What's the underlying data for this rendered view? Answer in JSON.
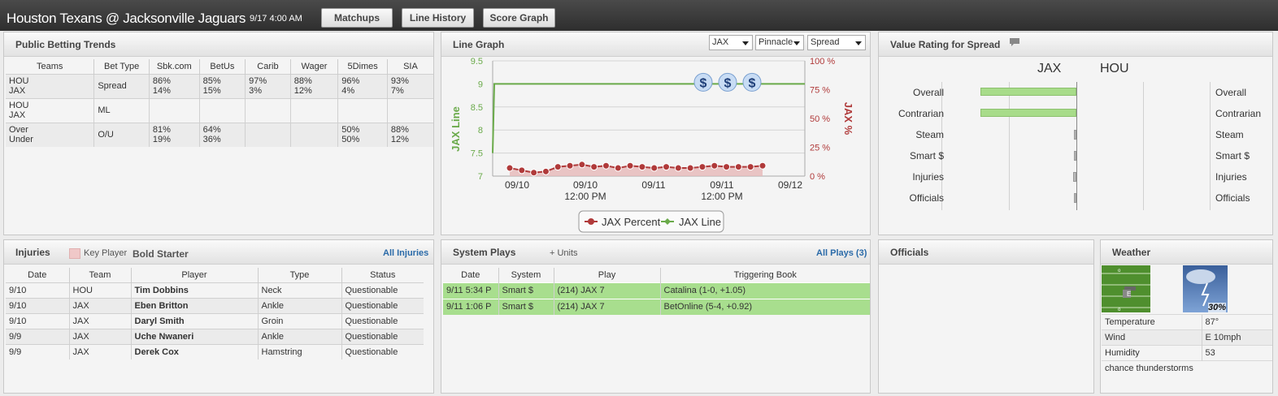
{
  "header": {
    "title": "Houston Texans @ Jacksonville Jaguars",
    "time": "9/17 4:00 AM",
    "buttons": [
      "Matchups",
      "Line History",
      "Score Graph"
    ]
  },
  "betting": {
    "title": "Public Betting Trends",
    "columns": [
      "Teams",
      "Bet Type",
      "Sbk.com",
      "BetUs",
      "Carib",
      "Wager",
      "5Dimes",
      "SIA"
    ],
    "rows": [
      {
        "teams": [
          "HOU",
          "JAX"
        ],
        "type": "Spread",
        "vals": [
          [
            "86%",
            "14%"
          ],
          [
            "85%",
            "15%"
          ],
          [
            "97%",
            "3%"
          ],
          [
            "88%",
            "12%"
          ],
          [
            "96%",
            "4%"
          ],
          [
            "93%",
            "7%"
          ]
        ]
      },
      {
        "teams": [
          "HOU",
          "JAX"
        ],
        "type": "ML",
        "vals": [
          [
            "",
            ""
          ],
          [
            "",
            ""
          ],
          [
            "",
            ""
          ],
          [
            "",
            ""
          ],
          [
            "",
            ""
          ],
          [
            "",
            ""
          ]
        ]
      },
      {
        "teams": [
          "Over",
          "Under"
        ],
        "type": "O/U",
        "vals": [
          [
            "81%",
            "19%"
          ],
          [
            "64%",
            "36%"
          ],
          [
            "",
            ""
          ],
          [
            "",
            ""
          ],
          [
            "50%",
            "50%"
          ],
          [
            "88%",
            "12%"
          ]
        ]
      }
    ]
  },
  "linegraph": {
    "title": "Line Graph",
    "selects": [
      "JAX",
      "Pinnacle",
      "Spread"
    ]
  },
  "chart_data": {
    "type": "line",
    "ylabel": "JAX Line",
    "y2label": "JAX %",
    "ylim": [
      7,
      9.5
    ],
    "yticks": [
      "9.5",
      "9",
      "8.5",
      "8",
      "7.5",
      "7"
    ],
    "y2ticks": [
      "100 %",
      "75 %",
      "50 %",
      "25 %",
      "0 %"
    ],
    "xticks": [
      [
        "09/10",
        ""
      ],
      [
        "09/10",
        "12:00 PM"
      ],
      [
        "09/11",
        ""
      ],
      [
        "09/11",
        "12:00 PM"
      ],
      [
        "09/12",
        ""
      ]
    ],
    "series": [
      {
        "name": "JAX Percent",
        "color": "#b03a3a",
        "values": [
          7,
          5,
          3,
          4,
          8,
          9,
          10,
          8,
          9,
          7,
          9,
          8,
          7,
          8,
          7,
          7,
          8,
          9,
          8,
          8,
          8,
          9
        ]
      },
      {
        "name": "JAX Line",
        "color": "#6aaa4a",
        "values": [
          7.5,
          9,
          9,
          9,
          9,
          9,
          9,
          9
        ]
      }
    ],
    "markers": [
      "$",
      "$",
      "$"
    ]
  },
  "value_rating": {
    "title": "Value Rating for Spread",
    "team_left": "JAX",
    "team_right": "HOU",
    "rows": [
      {
        "label": "Overall",
        "value": -0.8
      },
      {
        "label": "Contrarian",
        "value": -0.8
      },
      {
        "label": "Steam",
        "value": 0
      },
      {
        "label": "Smart $",
        "value": 0
      },
      {
        "label": "Injuries",
        "value": -0.03
      },
      {
        "label": "Officials",
        "value": 0
      }
    ]
  },
  "injuries": {
    "title": "Injuries",
    "legend_key": "Key Player",
    "legend_bold": "Bold Starter",
    "all_link": "All Injuries",
    "columns": [
      "Date",
      "Team",
      "Player",
      "Type",
      "Status"
    ],
    "rows": [
      [
        "9/10",
        "HOU",
        "Tim Dobbins",
        "Neck",
        "Questionable"
      ],
      [
        "9/10",
        "JAX",
        "Eben Britton",
        "Ankle",
        "Questionable"
      ],
      [
        "9/10",
        "JAX",
        "Daryl Smith",
        "Groin",
        "Questionable"
      ],
      [
        "9/9",
        "JAX",
        "Uche Nwaneri",
        "Ankle",
        "Questionable"
      ],
      [
        "9/9",
        "JAX",
        "Derek Cox",
        "Hamstring",
        "Questionable"
      ]
    ]
  },
  "system_plays": {
    "title": "System Plays",
    "units": "+ Units",
    "all_link": "All Plays (3)",
    "columns": [
      "Date",
      "System",
      "Play",
      "Triggering Book"
    ],
    "rows": [
      [
        "9/11 5:34 P",
        "Smart $",
        "(214) JAX 7",
        "Catalina (1-0, +1.05)"
      ],
      [
        "9/11 1:06 P",
        "Smart $",
        "(214) JAX 7",
        "BetOnline (5-4, +0.92)"
      ]
    ]
  },
  "officials": {
    "title": "Officials"
  },
  "weather": {
    "title": "Weather",
    "precip": "30%",
    "rows": [
      [
        "Temperature",
        "87°"
      ],
      [
        "Wind",
        "E 10mph"
      ],
      [
        "Humidity",
        "53"
      ]
    ],
    "summary": "chance thunderstorms"
  }
}
